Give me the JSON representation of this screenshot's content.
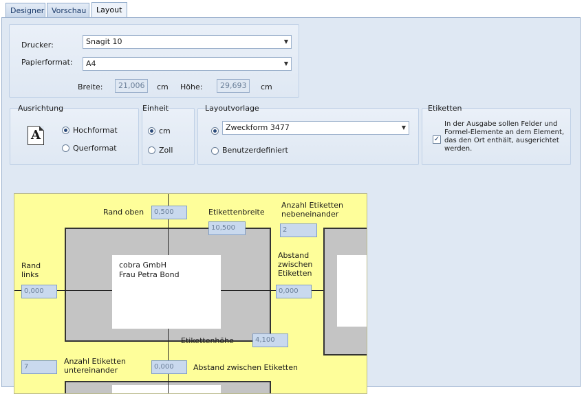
{
  "tabs": [
    {
      "label": "Designer",
      "active": false
    },
    {
      "label": "Vorschau",
      "active": false
    },
    {
      "label": "Layout",
      "active": true
    }
  ],
  "printer": {
    "drucker_label": "Drucker:",
    "drucker_value": "Snagit 10",
    "papier_label": "Papierformat:",
    "papier_value": "A4",
    "breite_label": "Breite:",
    "breite_value": "21,006",
    "breite_unit": "cm",
    "hoehe_label": "Höhe:",
    "hoehe_value": "29,693",
    "hoehe_unit": "cm"
  },
  "ausrichtung": {
    "title": "Ausrichtung",
    "icon_letter": "A",
    "options": [
      "Hochformat",
      "Querformat"
    ],
    "selected": "Hochformat"
  },
  "einheit": {
    "title": "Einheit",
    "options": [
      "cm",
      "Zoll"
    ],
    "selected": "cm"
  },
  "layoutvorlage": {
    "title": "Layoutvorlage",
    "combo_value": "Zweckform 3477",
    "custom_label": "Benutzerdefiniert",
    "selected": "preset"
  },
  "etiketten": {
    "title": "Etiketten",
    "checked": true,
    "text": "In der Ausgabe sollen Felder und Formel-Elemente an dem Element, das den Ort enthält, ausgerichtet werden."
  },
  "preview": {
    "rand_oben_label": "Rand oben",
    "rand_oben_value": "0,500",
    "etikettenbreite_label": "Etikettenbreite",
    "etikettenbreite_value": "10,500",
    "anzahl_neben_label_1": "Anzahl Etiketten",
    "anzahl_neben_label_2": "nebeneinander",
    "anzahl_neben_value": "2",
    "rand_links_label_1": "Rand",
    "rand_links_label_2": "links",
    "rand_links_value": "0,000",
    "abstand_label_1": "Abstand",
    "abstand_label_2": "zwischen",
    "abstand_label_3": "Etiketten",
    "abstand_value": "0,000",
    "address_line_1": "cobra GmbH",
    "address_line_2": "Frau Petra Bond",
    "etikettenhoehe_label": "Etikettenhöhe",
    "etikettenhoehe_value": "4,100",
    "anzahl_unter_value": "7",
    "anzahl_unter_label_1": "Anzahl Etiketten",
    "anzahl_unter_label_2": "untereinander",
    "abstand_vert_value": "0,000",
    "abstand_vert_label": "Abstand zwischen Etiketten"
  }
}
